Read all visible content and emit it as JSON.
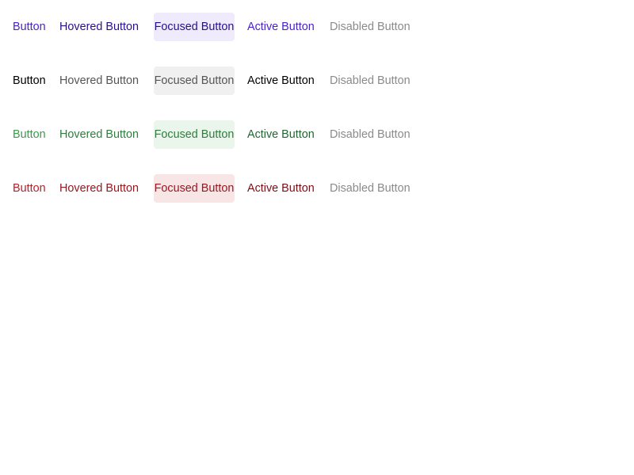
{
  "rows": [
    {
      "variant": "primary",
      "colors": {
        "default": "#4a23c7",
        "hovered": "#2a0f8c",
        "focused_text": "#2a0f8c",
        "focused_bg": "#efeafc",
        "active": "#4a23c7",
        "disabled": "#8a8a8a"
      },
      "buttons": [
        "Button",
        "Hovered Button",
        "Focused Button",
        "Active Button",
        "Disabled Button"
      ]
    },
    {
      "variant": "neutral",
      "colors": {
        "default": "#000000",
        "hovered": "#555555",
        "focused_text": "#555555",
        "focused_bg": "#f0f0f0",
        "active": "#000000",
        "disabled": "#8a8a8a"
      },
      "buttons": [
        "Button",
        "Hovered Button",
        "Focused Button",
        "Active Button",
        "Disabled Button"
      ]
    },
    {
      "variant": "success",
      "colors": {
        "default": "#3a9a4a",
        "hovered": "#2f7d3c",
        "focused_text": "#2f7d3c",
        "focused_bg": "#eaf6ec",
        "active": "#266332",
        "disabled": "#8a8a8a"
      },
      "buttons": [
        "Button",
        "Hovered Button",
        "Focused Button",
        "Active Button",
        "Disabled Button"
      ]
    },
    {
      "variant": "danger",
      "colors": {
        "default": "#b8202a",
        "hovered": "#961820",
        "focused_text": "#961820",
        "focused_bg": "#f8e6e7",
        "active": "#7a1017",
        "disabled": "#8a8a8a"
      },
      "buttons": [
        "Button",
        "Hovered Button",
        "Focused Button",
        "Active Button",
        "Disabled Button"
      ]
    }
  ]
}
